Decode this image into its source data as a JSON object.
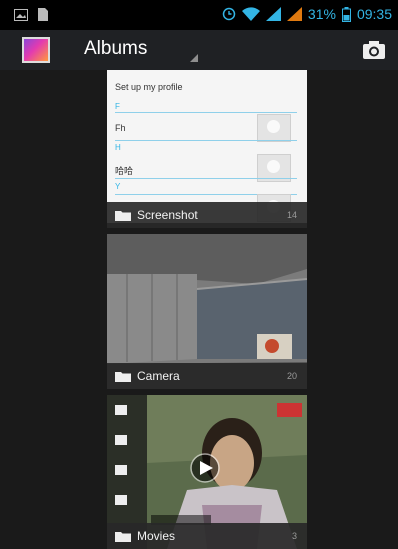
{
  "status_bar": {
    "battery_percent": "31%",
    "time": "09:35",
    "icons": [
      "image-icon",
      "sim-card-icon",
      "alarm-icon",
      "wifi-icon",
      "signal-icon",
      "signal-icon",
      "battery-icon"
    ],
    "accent_color": "#33b5e5"
  },
  "action_bar": {
    "title": "Albums",
    "icons": [
      "gallery-app-icon",
      "spinner-dropdown-icon",
      "camera-icon"
    ]
  },
  "albums": [
    {
      "name": "Screenshot",
      "count": "14",
      "preview": {
        "heading": "Set up my profile",
        "rows": [
          {
            "section": "F",
            "text": "Fh"
          },
          {
            "section": "H",
            "text": "哈哈"
          },
          {
            "section": "Y",
            "text": ""
          }
        ]
      }
    },
    {
      "name": "Camera",
      "count": "20"
    },
    {
      "name": "Movies",
      "count": "3",
      "video_overlay": "play-icon"
    }
  ]
}
